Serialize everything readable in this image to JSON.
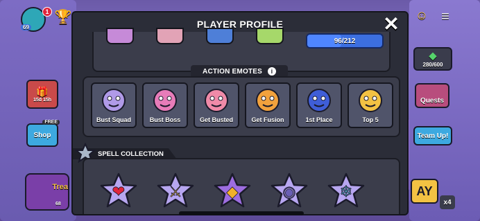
{
  "modal": {
    "title": "PLAYER PROFILE",
    "close_label": "✕"
  },
  "progress": {
    "text": "96/212",
    "fraction": 0.45
  },
  "emotes": {
    "section_label": "ACTION EMOTES",
    "info_label": "i",
    "items": [
      {
        "label": "Bust Squad",
        "art": "purple-squad-emote",
        "color": "#b09ae8"
      },
      {
        "label": "Bust Boss",
        "art": "pink-boss-emote",
        "color": "#e77cb9"
      },
      {
        "label": "Get Busted",
        "art": "pink-busted-emote",
        "color": "#f08aa8"
      },
      {
        "label": "Get Fusion",
        "art": "fusion-emote",
        "color": "#f2a23d"
      },
      {
        "label": "1st Place",
        "art": "robot-trophy-emote",
        "color": "#3f5ed8"
      },
      {
        "label": "Top 5",
        "art": "cheering-emote",
        "color": "#f3c243"
      }
    ]
  },
  "spells": {
    "section_label": "SPELL COLLECTION",
    "items": [
      {
        "name": "heart-spell-icon",
        "star_color": "#b7a6f0",
        "symbol": "❤",
        "symbol_color": "#e0263d"
      },
      {
        "name": "sword-spell-icon",
        "star_color": "#b7a6f0",
        "symbol": "⚔",
        "symbol_color": "#f2c14e"
      },
      {
        "name": "gem-spell-icon",
        "star_color": "#9d6de0",
        "symbol": "◆",
        "symbol_color": "#f1b12a"
      },
      {
        "name": "cannon-spell-icon",
        "star_color": "#b7a6f0",
        "symbol": "◉",
        "symbol_color": "#6a5fb5"
      },
      {
        "name": "snowflake-spell-icon",
        "star_color": "#b7a6f0",
        "symbol": "❄",
        "symbol_color": "#6cd4f7"
      }
    ]
  },
  "hud": {
    "level_badge": "69",
    "notification_count": "1",
    "resource_text": "280/600",
    "timer_text": "15d 15h",
    "free_tag": "FREE",
    "shop_label": "Shop",
    "quests_label": "Quests",
    "team_up_label": "Team Up!",
    "treasure_label": "Trea",
    "treasure_count": "68",
    "multiplier": "x4",
    "play_partial": "AY"
  },
  "colors": {
    "modal_bg": "#2b2d38",
    "panel_bg": "#3b3d4b",
    "card_bg": "#50546a",
    "accent_blue": "#3c6fe0"
  }
}
